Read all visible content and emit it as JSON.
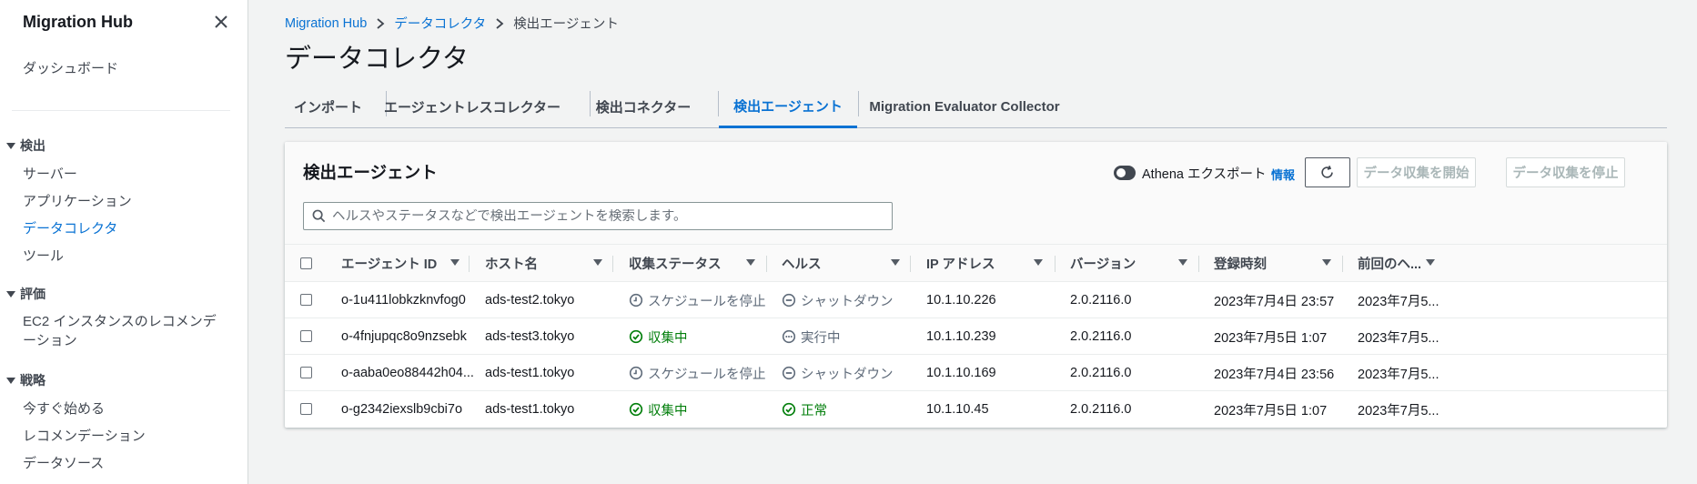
{
  "sidebar": {
    "title": "Migration Hub",
    "dashboard": "ダッシュボード",
    "sections": {
      "discover": {
        "label": "検出",
        "items": [
          "サーバー",
          "アプリケーション",
          "データコレクタ",
          "ツール"
        ]
      },
      "assess": {
        "label": "評価",
        "items": [
          "EC2 インスタンスのレコメンデーション"
        ]
      },
      "strategy": {
        "label": "戦略",
        "items": [
          "今すぐ始める",
          "レコメンデーション",
          "データソース"
        ]
      }
    },
    "active_item": "データコレクタ"
  },
  "breadcrumb": [
    "Migration Hub",
    "データコレクタ",
    "検出エージェント"
  ],
  "page_title": "データコレクタ",
  "tabs": [
    "インポート",
    "エージェントレスコレクター",
    "検出コネクター",
    "検出エージェント",
    "Migration Evaluator Collector"
  ],
  "active_tab": "検出エージェント",
  "panel": {
    "title": "検出エージェント",
    "athena_label": "Athena エクスポート",
    "info_link": "情報",
    "start_button": "データ収集を開始",
    "stop_button": "データ収集を停止",
    "search_placeholder": "ヘルスやステータスなどで検出エージェントを検索します。"
  },
  "table": {
    "columns": [
      "エージェント ID",
      "ホスト名",
      "収集ステータス",
      "ヘルス",
      "IP アドレス",
      "バージョン",
      "登録時刻",
      "前回のヘ..."
    ],
    "rows": [
      {
        "agent_id": "o-1u411lobkzknvfog0",
        "host": "ads-test2.tokyo",
        "collection_status": "スケジュールを停止",
        "collection_status_kind": "stopped",
        "health": "シャットダウン",
        "health_kind": "shutdown",
        "ip": "10.1.10.226",
        "version": "2.0.2116.0",
        "registered": "2023年7月4日 23:57",
        "last_health": "2023年7月5..."
      },
      {
        "agent_id": "o-4fnjupqc8o9nzsebk",
        "host": "ads-test3.tokyo",
        "collection_status": "収集中",
        "collection_status_kind": "collecting",
        "health": "実行中",
        "health_kind": "running",
        "ip": "10.1.10.239",
        "version": "2.0.2116.0",
        "registered": "2023年7月5日 1:07",
        "last_health": "2023年7月5..."
      },
      {
        "agent_id": "o-aaba0eo88442h04...",
        "host": "ads-test1.tokyo",
        "collection_status": "スケジュールを停止",
        "collection_status_kind": "stopped",
        "health": "シャットダウン",
        "health_kind": "shutdown",
        "ip": "10.1.10.169",
        "version": "2.0.2116.0",
        "registered": "2023年7月4日 23:56",
        "last_health": "2023年7月5..."
      },
      {
        "agent_id": "o-g2342iexslb9cbi7o",
        "host": "ads-test1.tokyo",
        "collection_status": "収集中",
        "collection_status_kind": "collecting",
        "health": "正常",
        "health_kind": "healthy",
        "ip": "10.1.10.45",
        "version": "2.0.2116.0",
        "registered": "2023年7月5日 1:07",
        "last_health": "2023年7月5..."
      }
    ]
  },
  "colors": {
    "link_blue": "#0972d3",
    "success_green": "#037f0c",
    "neutral_gray": "#5f6b7a"
  }
}
